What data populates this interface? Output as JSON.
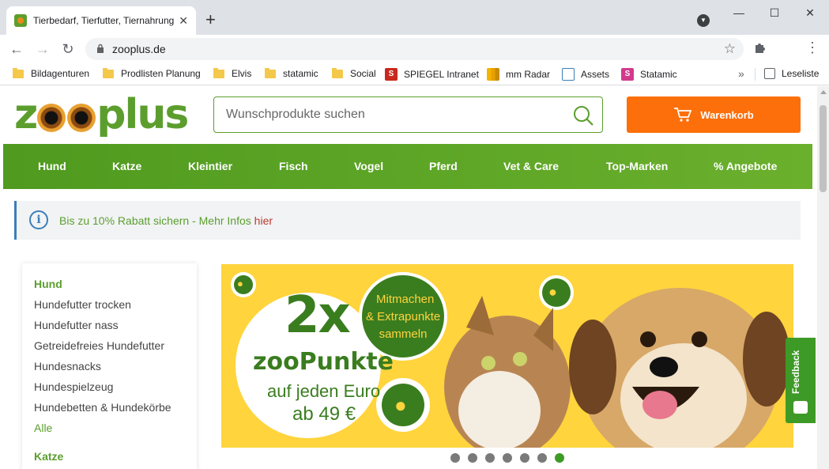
{
  "browser": {
    "tab_title": "Tierbedarf, Tierfutter, Tiernahrung",
    "tab_close": "✕",
    "new_tab": "+",
    "url": "zooplus.de",
    "window_minimize": "—",
    "window_maximize": "☐",
    "window_close": "✕",
    "bookmarks": [
      {
        "label": "Bildagenturen",
        "icon": "folder-icon"
      },
      {
        "label": "Prodlisten Planung",
        "icon": "folder-icon"
      },
      {
        "label": "Elvis",
        "icon": "folder-icon"
      },
      {
        "label": "statamic",
        "icon": "folder-icon"
      },
      {
        "label": "Social",
        "icon": "folder-icon"
      },
      {
        "label": "SPIEGEL Intranet",
        "icon": "spiegel-icon"
      },
      {
        "label": "mm Radar",
        "icon": "chart-icon"
      },
      {
        "label": "Assets",
        "icon": "assets-icon"
      },
      {
        "label": "Statamic",
        "icon": "statamic-icon"
      }
    ],
    "bookmarks_more": "»",
    "reading_list": "Leseliste"
  },
  "site": {
    "logo_text": "zooplus",
    "search_placeholder": "Wunschprodukte suchen",
    "cart_label": "Warenkorb",
    "nav": [
      "Hund",
      "Katze",
      "Kleintier",
      "Fisch",
      "Vogel",
      "Pferd",
      "Vet & Care",
      "Top-Marken",
      "% Angebote"
    ],
    "info": {
      "text": "Bis zu 10% Rabatt sichern - Mehr Infos ",
      "link": "hier"
    },
    "sidebar": {
      "hund_heading": "Hund",
      "hund_items": [
        "Hundefutter trocken",
        "Hundefutter nass",
        "Getreidefreies Hundefutter",
        "Hundesnacks",
        "Hundespielzeug",
        "Hundebetten & Hundekörbe"
      ],
      "all_label": "Alle",
      "katze_heading": "Katze"
    },
    "banner": {
      "big": "2x",
      "title": "zooPunkte",
      "sub1": "auf jeden Euro",
      "sub2": "ab 49 €",
      "circle_line1": "Mitmachen",
      "circle_line2": "& Extrapunkte",
      "circle_line3": "sammeln"
    },
    "carousel": {
      "count": 7,
      "active": 7
    },
    "feedback_label": "Feedback",
    "colors": {
      "brand_green": "#5c9e2e",
      "cart_orange": "#fc6f0a",
      "banner_yellow": "#ffd43d",
      "info_blue": "#3b7eb8"
    }
  }
}
